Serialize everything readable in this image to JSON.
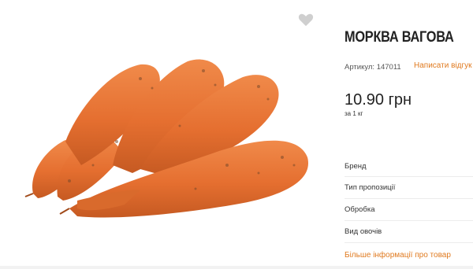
{
  "product": {
    "title": "МОРКВА ВАГОВА",
    "article": "Артикул: 147011",
    "review_link": "Написати відгук",
    "price": "10.90 грн",
    "unit": "за 1 кг",
    "image_icon": "carrots-product-image",
    "favorite_icon": "heart-icon"
  },
  "specs": [
    {
      "label": "Бренд"
    },
    {
      "label": "Тип пропозиції"
    },
    {
      "label": "Обробка"
    },
    {
      "label": "Вид овочів"
    }
  ],
  "more_info_link": "Більше інформації про товар",
  "colors": {
    "accent": "#e07a1f",
    "carrot": "#e8743a",
    "text": "#222222"
  }
}
